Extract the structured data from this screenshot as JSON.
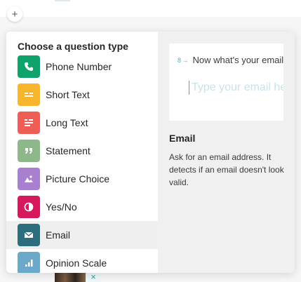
{
  "background": {
    "add_button_label": "+",
    "thumbnail_close_label": "×"
  },
  "picker": {
    "title": "Choose a question type",
    "items": [
      {
        "label": "Phone Number",
        "icon": "phone-icon",
        "color": "#0fa36b",
        "selected": false
      },
      {
        "label": "Short Text",
        "icon": "short-text-icon",
        "color": "#f7b52c",
        "selected": false
      },
      {
        "label": "Long Text",
        "icon": "long-text-icon",
        "color": "#ee5e57",
        "selected": false
      },
      {
        "label": "Statement",
        "icon": "quote-icon",
        "color": "#8fb88a",
        "selected": false
      },
      {
        "label": "Picture Choice",
        "icon": "picture-icon",
        "color": "#a97fd0",
        "selected": false
      },
      {
        "label": "Yes/No",
        "icon": "yes-no-icon",
        "color": "#d6195d",
        "selected": false
      },
      {
        "label": "Email",
        "icon": "envelope-icon",
        "color": "#2d6e7e",
        "selected": true
      },
      {
        "label": "Opinion Scale",
        "icon": "bar-chart-icon",
        "color": "#6ba8c9",
        "selected": false
      }
    ]
  },
  "preview": {
    "question_number": "8",
    "question_arrow": "→",
    "question_text": "Now what's your email?",
    "input_placeholder": "Type your email here..."
  },
  "detail": {
    "title": "Email",
    "description": "Ask for an email address. It detects if an email doesn't look valid."
  }
}
